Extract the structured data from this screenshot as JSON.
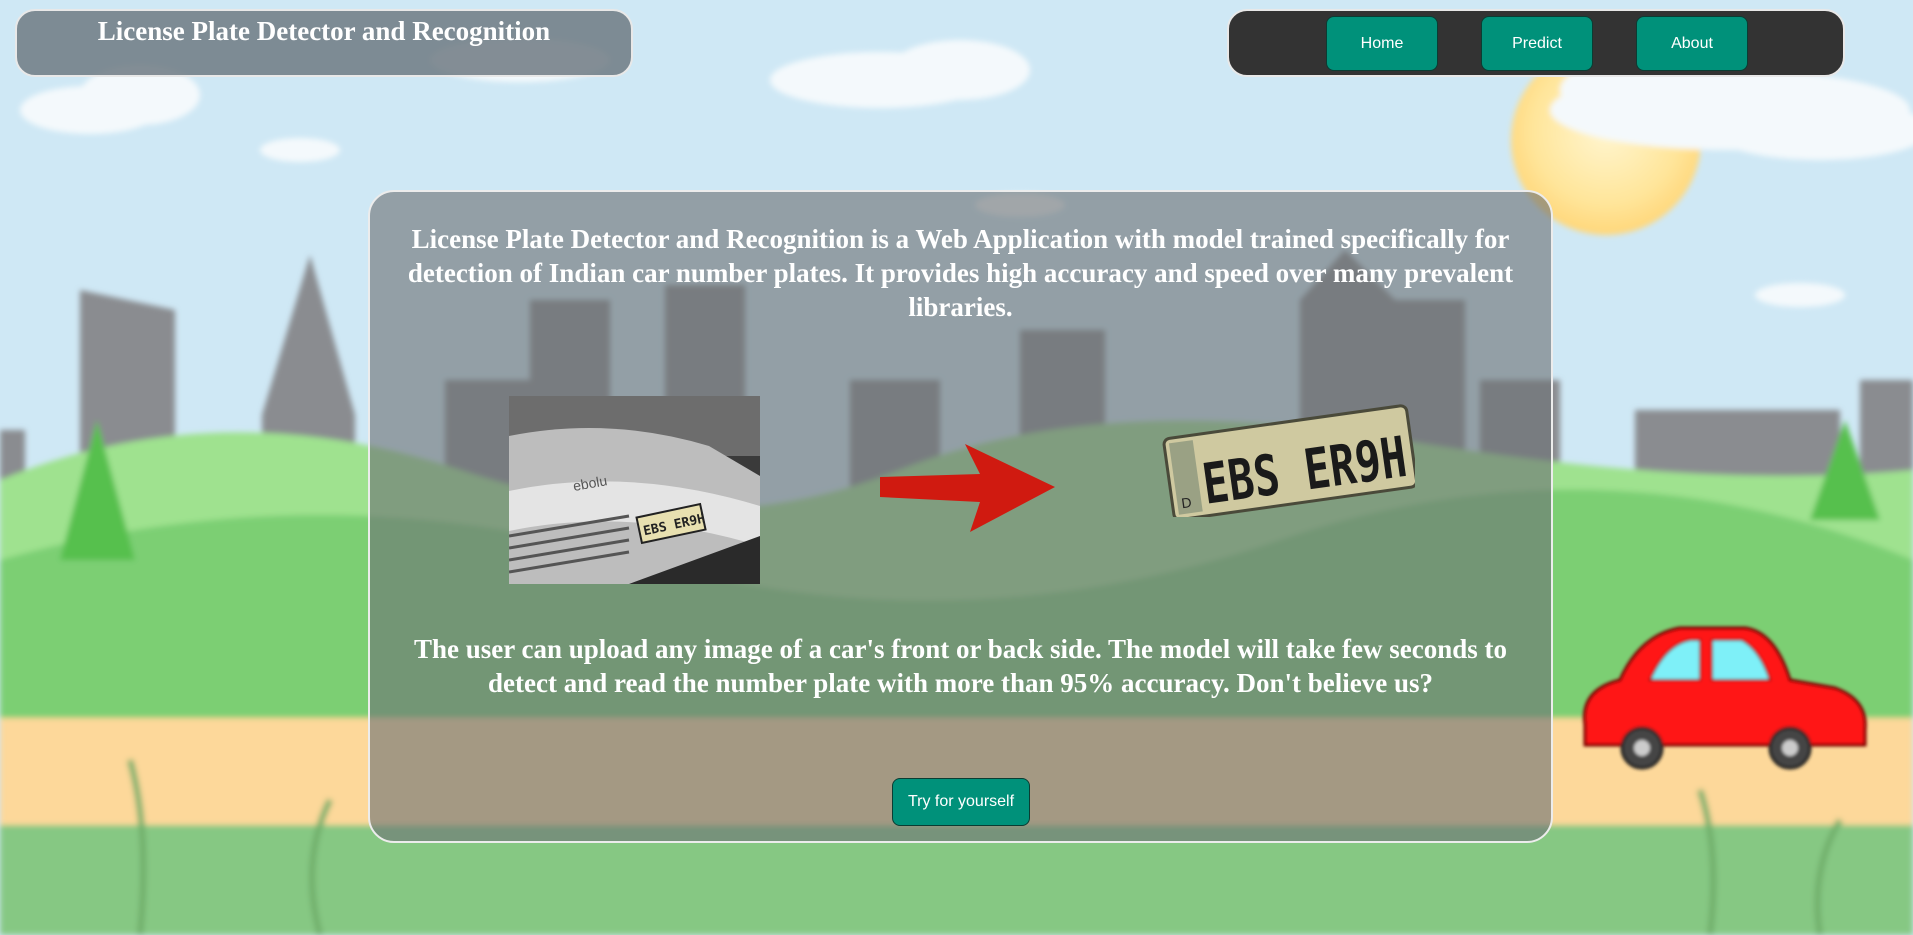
{
  "header": {
    "title": "License Plate Detector and Recognition"
  },
  "nav": {
    "items": [
      {
        "label": "Home"
      },
      {
        "label": "Predict"
      },
      {
        "label": "About"
      }
    ]
  },
  "main": {
    "intro": "License Plate Detector and Recognition is a Web Application with model trained specifically for detection of Indian car number plates. It provides high accuracy and speed over many prevalent libraries.",
    "description": "The user can upload any image of a car's front or back side. The model will take few seconds to detect and read the number plate with more than 95% accuracy. Don't believe us?",
    "cta_label": "Try for yourself",
    "sample_plate_text": "EBS ER9H",
    "cropped_plate_text": "EBS ER9H",
    "plate_prefix": "D"
  },
  "colors": {
    "button": "#00917a",
    "nav_bg": "#333333",
    "arrow": "#d01a10",
    "car": "#ff1a1a"
  }
}
